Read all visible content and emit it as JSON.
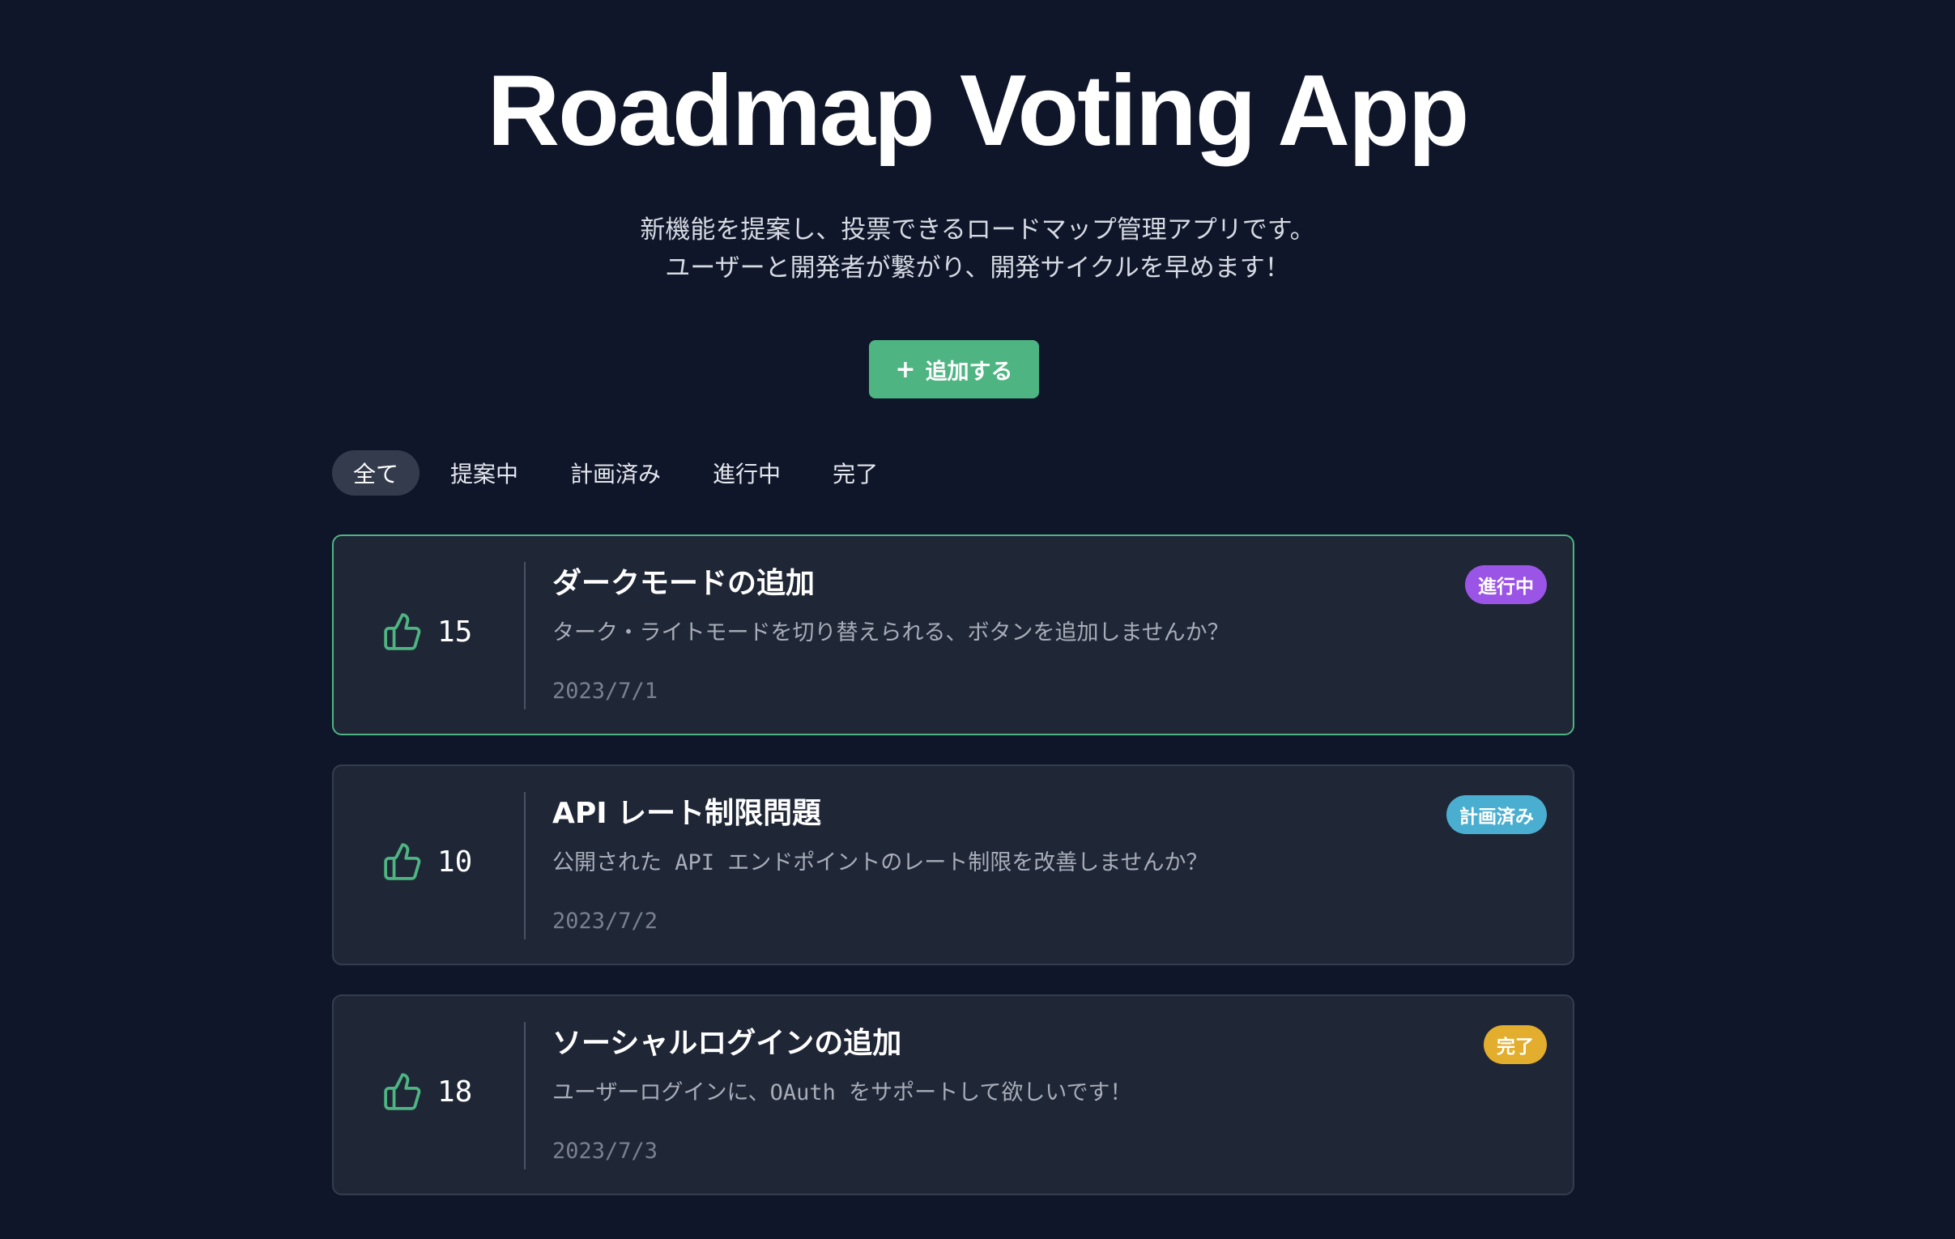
{
  "header": {
    "title": "Roadmap Voting App",
    "subtitle_line1": "新機能を提案し、投票できるロードマップ管理アプリです。",
    "subtitle_line2": "ユーザーと開発者が繋がり、開発サイクルを早めます！"
  },
  "actions": {
    "add_icon": "+",
    "add_label": "追加する"
  },
  "filters": {
    "selected": "全て",
    "tabs": [
      "全て",
      "提案中",
      "計画済み",
      "進行中",
      "完了"
    ]
  },
  "colors": {
    "accent": "#4eb582",
    "status_in_progress": "#9b55e6",
    "status_planned": "#4aaed0",
    "status_done": "#e3ad2d"
  },
  "items": [
    {
      "votes": "15",
      "title": "ダークモードの追加",
      "description": "ターク・ライトモードを切り替えられる、ボタンを追加しませんか？",
      "date": "2023/7/1",
      "status": "進行中",
      "status_color": "#9b55e6"
    },
    {
      "votes": "10",
      "title": "API レート制限問題",
      "description": "公開された API エンドポイントのレート制限を改善しませんか？",
      "date": "2023/7/2",
      "status": "計画済み",
      "status_color": "#4aaed0"
    },
    {
      "votes": "18",
      "title": "ソーシャルログインの追加",
      "description": "ユーザーログインに、OAuth をサポートして欲しいです！",
      "date": "2023/7/3",
      "status": "完了",
      "status_color": "#e3ad2d"
    }
  ]
}
